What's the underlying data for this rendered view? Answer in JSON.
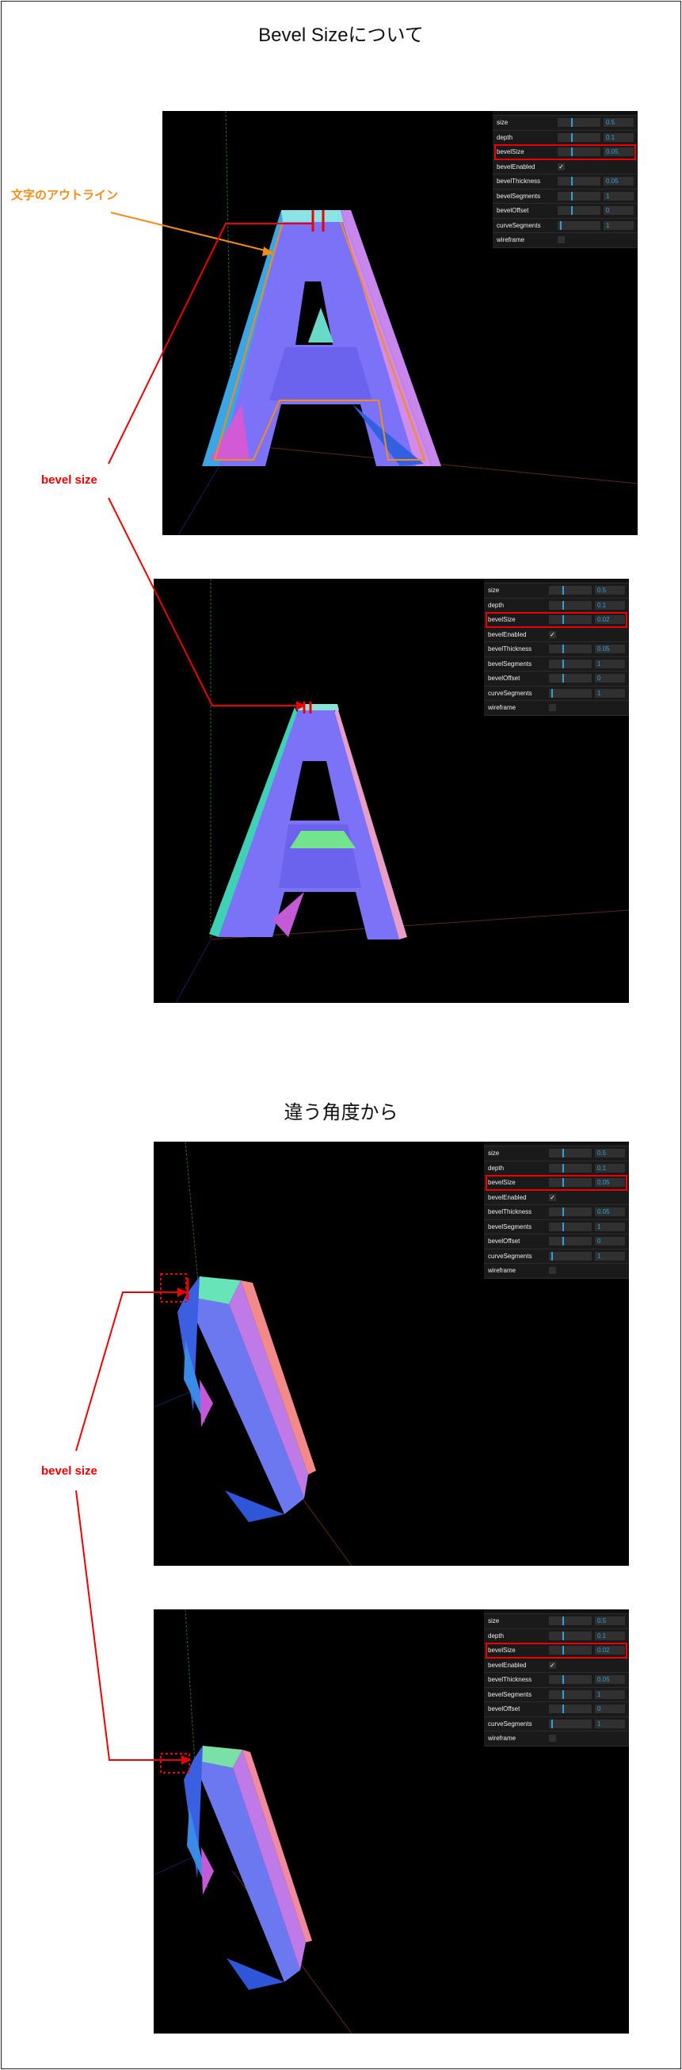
{
  "headings": {
    "top": "Bevel Sizeについて",
    "bottom": "違う角度から"
  },
  "annotations": {
    "outline_label": "文字のアウトライン",
    "bevel_size_label": "bevel size"
  },
  "colors": {
    "outline": "#f28c1b",
    "bevel_marker": "#ff1a1a",
    "gui_accent": "#2fa1d6"
  },
  "panels": [
    {
      "gui": [
        {
          "label": "size",
          "type": "slider",
          "value": "0.5",
          "fill": 0.32
        },
        {
          "label": "depth",
          "type": "slider",
          "value": "0.1",
          "fill": 0.32
        },
        {
          "label": "bevelSize",
          "type": "slider",
          "value": "0.05",
          "fill": 0.32,
          "highlight": true
        },
        {
          "label": "bevelEnabled",
          "type": "check",
          "checked": true
        },
        {
          "label": "bevelThickness",
          "type": "slider",
          "value": "0.05",
          "fill": 0.32
        },
        {
          "label": "bevelSegments",
          "type": "slider",
          "value": "1",
          "fill": 0.32
        },
        {
          "label": "bevelOffset",
          "type": "slider",
          "value": "0",
          "fill": 0.32
        },
        {
          "label": "curveSegments",
          "type": "slider",
          "value": "1",
          "fill": 0.05
        },
        {
          "label": "wireframe",
          "type": "check",
          "checked": false
        }
      ]
    },
    {
      "gui": [
        {
          "label": "size",
          "type": "slider",
          "value": "0.5",
          "fill": 0.32
        },
        {
          "label": "depth",
          "type": "slider",
          "value": "0.1",
          "fill": 0.32
        },
        {
          "label": "bevelSize",
          "type": "slider",
          "value": "0.02",
          "fill": 0.32,
          "highlight": true
        },
        {
          "label": "bevelEnabled",
          "type": "check",
          "checked": true
        },
        {
          "label": "bevelThickness",
          "type": "slider",
          "value": "0.05",
          "fill": 0.32
        },
        {
          "label": "bevelSegments",
          "type": "slider",
          "value": "1",
          "fill": 0.32
        },
        {
          "label": "bevelOffset",
          "type": "slider",
          "value": "0",
          "fill": 0.32
        },
        {
          "label": "curveSegments",
          "type": "slider",
          "value": "1",
          "fill": 0.05
        },
        {
          "label": "wireframe",
          "type": "check",
          "checked": false
        }
      ]
    },
    {
      "gui": [
        {
          "label": "size",
          "type": "slider",
          "value": "0.5",
          "fill": 0.32
        },
        {
          "label": "depth",
          "type": "slider",
          "value": "0.1",
          "fill": 0.32
        },
        {
          "label": "bevelSize",
          "type": "slider",
          "value": "0.05",
          "fill": 0.32,
          "highlight": true
        },
        {
          "label": "bevelEnabled",
          "type": "check",
          "checked": true
        },
        {
          "label": "bevelThickness",
          "type": "slider",
          "value": "0.05",
          "fill": 0.32
        },
        {
          "label": "bevelSegments",
          "type": "slider",
          "value": "1",
          "fill": 0.32
        },
        {
          "label": "bevelOffset",
          "type": "slider",
          "value": "0",
          "fill": 0.32
        },
        {
          "label": "curveSegments",
          "type": "slider",
          "value": "1",
          "fill": 0.05
        },
        {
          "label": "wireframe",
          "type": "check",
          "checked": false
        }
      ]
    },
    {
      "gui": [
        {
          "label": "size",
          "type": "slider",
          "value": "0.5",
          "fill": 0.32
        },
        {
          "label": "depth",
          "type": "slider",
          "value": "0.1",
          "fill": 0.32
        },
        {
          "label": "bevelSize",
          "type": "slider",
          "value": "0.02",
          "fill": 0.32,
          "highlight": true
        },
        {
          "label": "bevelEnabled",
          "type": "check",
          "checked": true
        },
        {
          "label": "bevelThickness",
          "type": "slider",
          "value": "0.05",
          "fill": 0.32
        },
        {
          "label": "bevelSegments",
          "type": "slider",
          "value": "1",
          "fill": 0.32
        },
        {
          "label": "bevelOffset",
          "type": "slider",
          "value": "0",
          "fill": 0.32
        },
        {
          "label": "curveSegments",
          "type": "slider",
          "value": "1",
          "fill": 0.05
        },
        {
          "label": "wireframe",
          "type": "check",
          "checked": false
        }
      ]
    }
  ]
}
